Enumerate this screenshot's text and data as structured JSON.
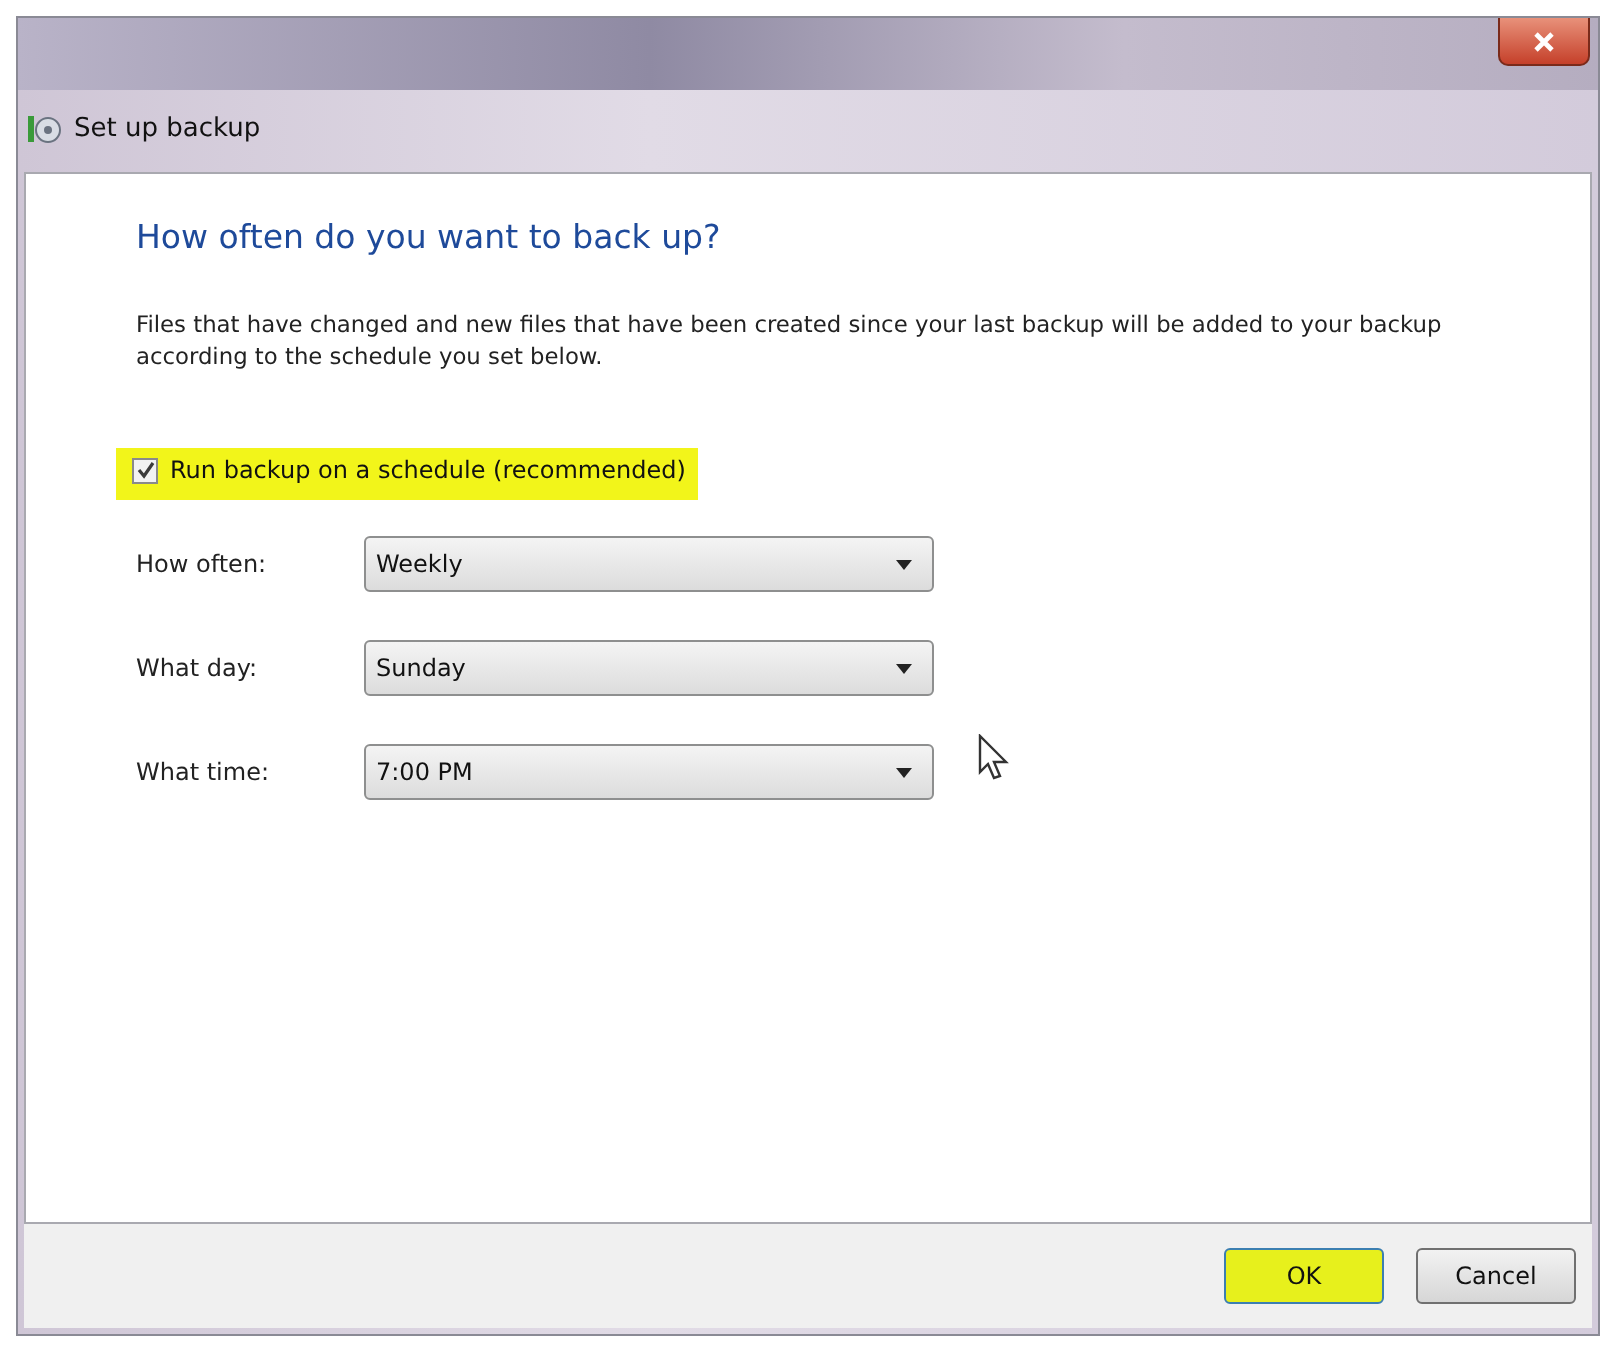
{
  "window": {
    "title": "Set up backup"
  },
  "heading": "How often do you want to back up?",
  "description": "Files that have changed and new files that have been created since your last backup will be added to your backup according to the schedule you set below.",
  "schedule_checkbox": {
    "label": "Run backup on a schedule (recommended)",
    "checked": true,
    "highlighted": true
  },
  "fields": [
    {
      "label": "How often:",
      "value": "Weekly"
    },
    {
      "label": "What day:",
      "value": "Sunday"
    },
    {
      "label": "What time:",
      "value": "7:00 PM"
    }
  ],
  "buttons": [
    {
      "label": "OK",
      "highlighted": true
    },
    {
      "label": "Cancel",
      "highlighted": false
    }
  ]
}
